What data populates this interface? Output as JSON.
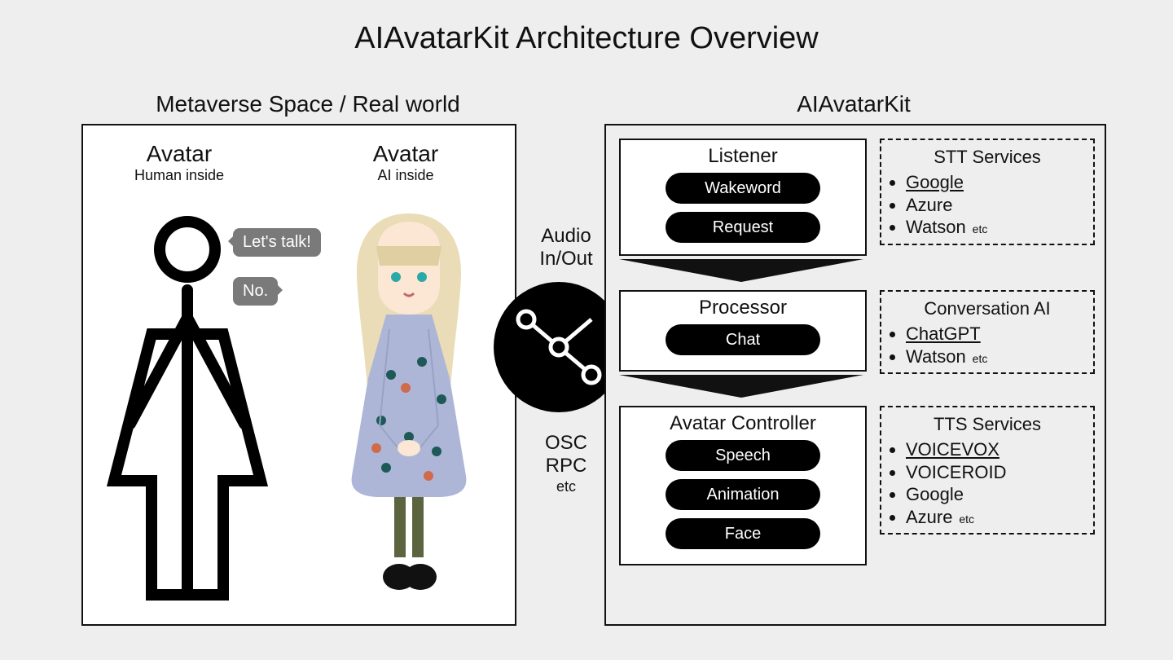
{
  "title": "AIAvatarKit Architecture Overview",
  "left": {
    "section_label": "Metaverse Space / Real world",
    "human_avatar": {
      "title": "Avatar",
      "subtitle": "Human inside"
    },
    "ai_avatar": {
      "title": "Avatar",
      "subtitle": "AI inside"
    },
    "bubble_human": "Let's talk!",
    "bubble_ai": "No."
  },
  "middle": {
    "audio_label_l1": "Audio",
    "audio_label_l2": "In/Out",
    "proto_l1": "OSC",
    "proto_l2": "RPC",
    "proto_etc": "etc"
  },
  "right": {
    "section_label": "AIAvatarKit",
    "pipeline": {
      "listener": {
        "title": "Listener",
        "pills": [
          "Wakeword",
          "Request"
        ]
      },
      "processor": {
        "title": "Processor",
        "pills": [
          "Chat"
        ]
      },
      "controller": {
        "title": "Avatar Controller",
        "pills": [
          "Speech",
          "Animation",
          "Face"
        ]
      }
    },
    "services": {
      "stt": {
        "title": "STT Services",
        "items": [
          {
            "label": "Google",
            "underline": true
          },
          {
            "label": "Azure"
          },
          {
            "label": "Watson",
            "etc": true
          }
        ]
      },
      "conv": {
        "title": "Conversation AI",
        "items": [
          {
            "label": "ChatGPT",
            "underline": true
          },
          {
            "label": "Watson",
            "etc": true
          }
        ]
      },
      "tts": {
        "title": "TTS Services",
        "items": [
          {
            "label": "VOICEVOX",
            "underline": true
          },
          {
            "label": "VOICEROID"
          },
          {
            "label": "Google"
          },
          {
            "label": "Azure",
            "etc": true
          }
        ]
      }
    }
  }
}
